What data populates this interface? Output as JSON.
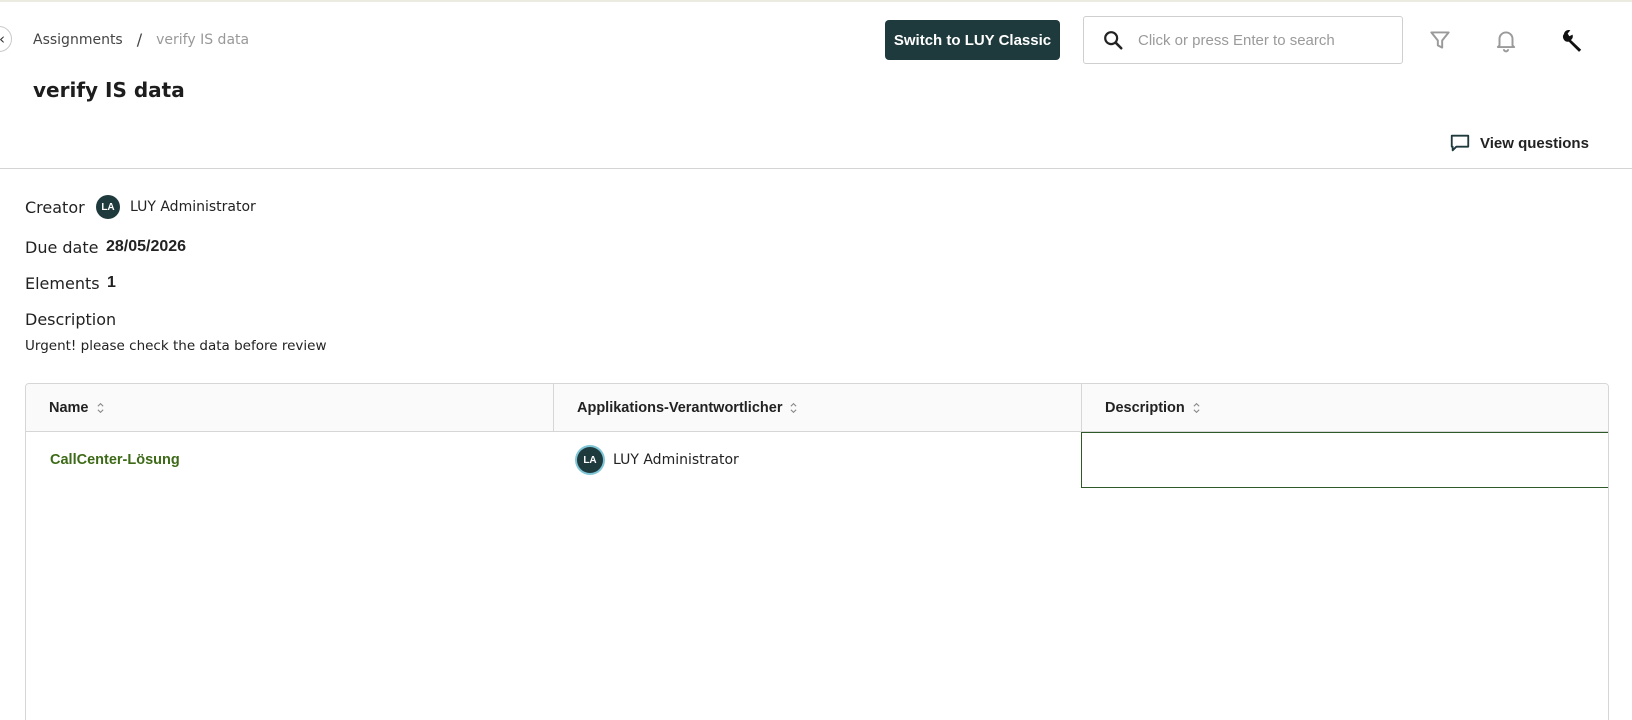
{
  "breadcrumb": {
    "parent": "Assignments",
    "separator": "/",
    "current": "verify IS data"
  },
  "page": {
    "title": "verify IS data"
  },
  "header": {
    "switch_button": "Switch to LUY Classic",
    "search_placeholder": "Click or press Enter to search",
    "icons": [
      "filter-icon",
      "bell-icon",
      "wrench-icon"
    ]
  },
  "actions": {
    "view_questions": "View questions"
  },
  "details": {
    "creator_label": "Creator",
    "creator_initials": "LA",
    "creator_name": "LUY Administrator",
    "due_date_label": "Due date",
    "due_date": "28/05/2026",
    "elements_label": "Elements",
    "elements_count": "1",
    "description_label": "Description",
    "description": "Urgent! please check the data before review"
  },
  "table": {
    "columns": [
      "Name",
      "Applikations-Verantwortlicher",
      "Description"
    ],
    "rows": [
      {
        "name": "CallCenter-Lösung",
        "owner_initials": "LA",
        "owner": "LUY Administrator",
        "description": ""
      }
    ]
  },
  "colors": {
    "primary_dark": "#1f3a3d",
    "link_green": "#3d6a17"
  }
}
